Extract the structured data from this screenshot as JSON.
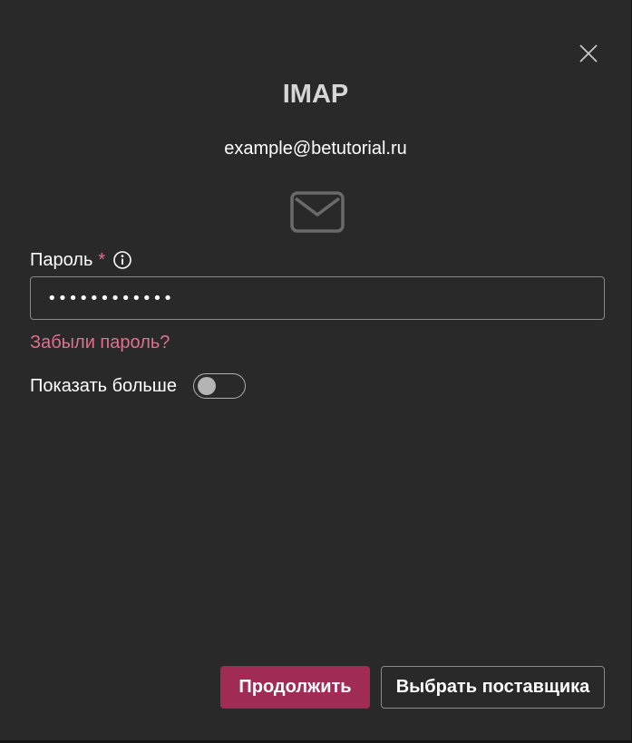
{
  "dialog": {
    "title": "IMAP",
    "email": "example@betutorial.ru",
    "close_icon": "close-icon",
    "mail_icon": "envelope-icon"
  },
  "password": {
    "label": "Пароль",
    "required_mark": "*",
    "info_icon": "info-icon",
    "value": "............"
  },
  "links": {
    "forgot_password": "Забыли пароль?"
  },
  "show_more": {
    "label": "Показать больше",
    "enabled": false
  },
  "buttons": {
    "continue": "Продолжить",
    "choose_provider": "Выбрать поставщика"
  },
  "colors": {
    "background": "#292929",
    "accent": "#a02c55",
    "link": "#e0708e",
    "border": "#8a8a8a"
  }
}
